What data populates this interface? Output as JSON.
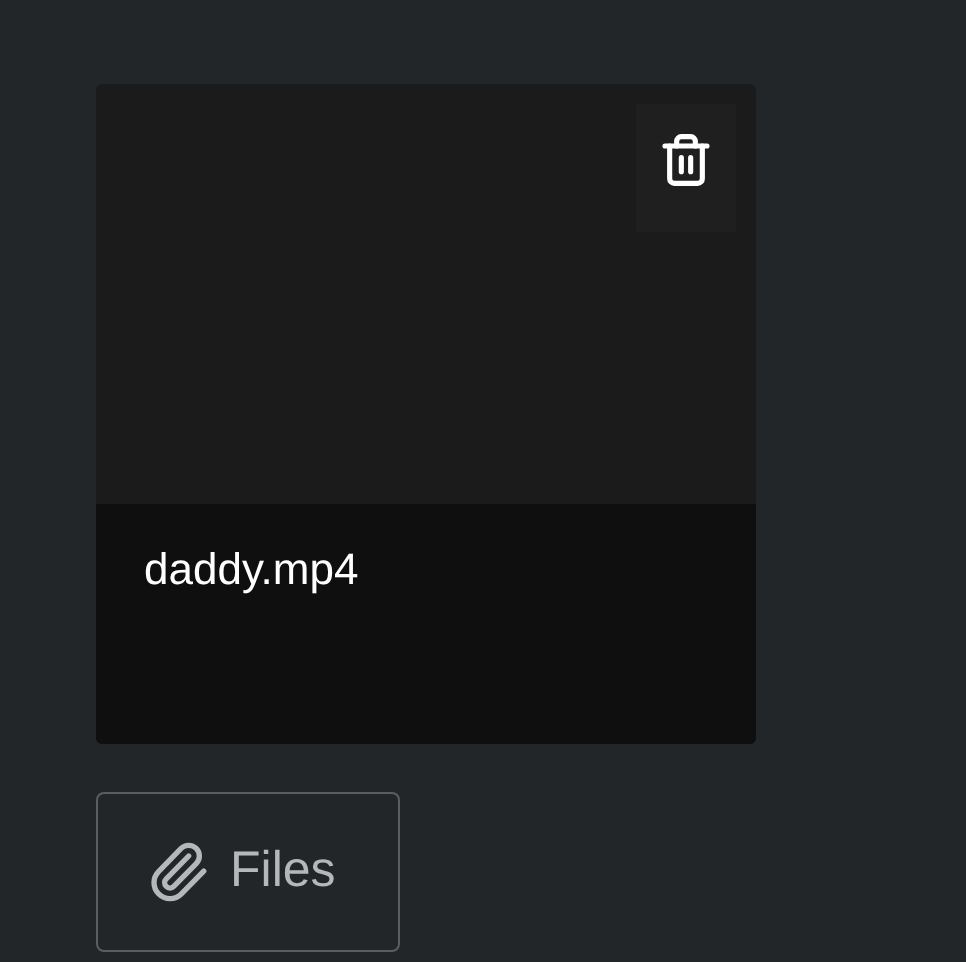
{
  "attachment": {
    "file_name": "daddy.mp4"
  },
  "files_button": {
    "label": "Files"
  }
}
